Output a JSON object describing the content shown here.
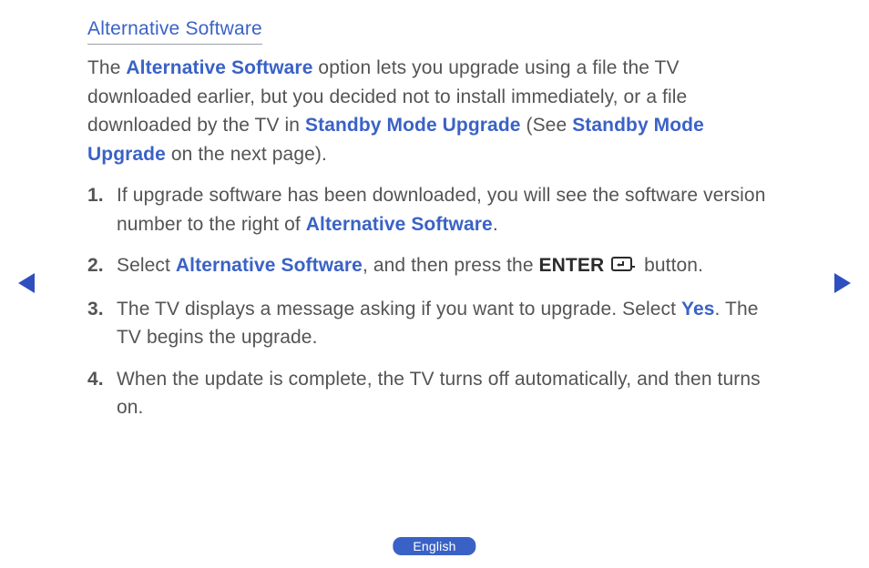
{
  "heading": "Alternative Software",
  "intro": {
    "t1": "The ",
    "t2": "Alternative Software",
    "t3": " option lets you upgrade using a file the TV downloaded earlier, but you decided not to install immediately, or a file downloaded by the TV in ",
    "t4": "Standby Mode Upgrade",
    "t5": " (See ",
    "t6": "Standby Mode Upgrade",
    "t7": " on the next page)."
  },
  "steps": {
    "s1": {
      "a": "If upgrade software has been downloaded, you will see the software version number to the right of ",
      "b": "Alternative Software",
      "c": "."
    },
    "s2": {
      "a": "Select ",
      "b": "Alternative Software",
      "c": ", and then press the ",
      "d": "ENTER",
      "e": " button."
    },
    "s3": {
      "a": "The TV displays a message asking if you want to upgrade. Select ",
      "b": "Yes",
      "c": ". The TV begins the upgrade."
    },
    "s4": {
      "a": "When the update is complete, the TV turns off automatically, and then turns on."
    }
  },
  "language": "English"
}
